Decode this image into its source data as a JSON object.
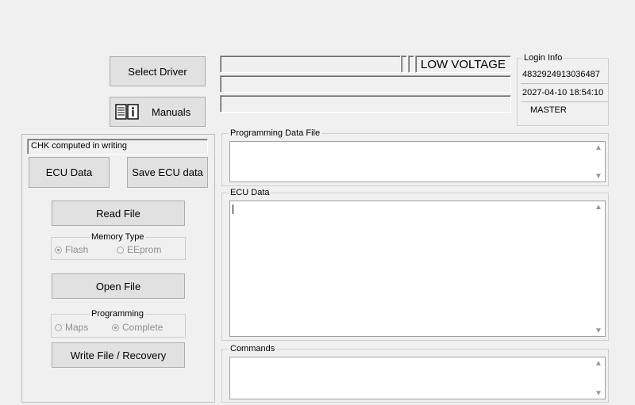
{
  "top": {
    "select_driver": "Select Driver",
    "manuals": "Manuals",
    "status_low_voltage": "LOW VOLTAGE",
    "book-icon": "book-info-icon"
  },
  "login": {
    "title": "Login Info",
    "id": "4832924913036487",
    "datetime": "2027-04-10 18:54:10",
    "role": "MASTER"
  },
  "left": {
    "chk_text": "CHK computed in writing",
    "ecu_data_btn": "ECU Data",
    "save_ecu_btn": "Save ECU data",
    "read_file_btn": "Read File",
    "memory_type": {
      "title": "Memory Type",
      "options": [
        "Flash",
        "EEprom"
      ],
      "selected": "Flash"
    },
    "open_file_btn": "Open File",
    "programming": {
      "title": "Programming",
      "options": [
        "Maps",
        "Complete"
      ],
      "selected": "Complete"
    },
    "write_btn": "Write File / Recovery"
  },
  "panels": {
    "prog_file_title": "Programming Data File",
    "ecu_data_title": "ECU Data",
    "commands_title": "Commands"
  }
}
